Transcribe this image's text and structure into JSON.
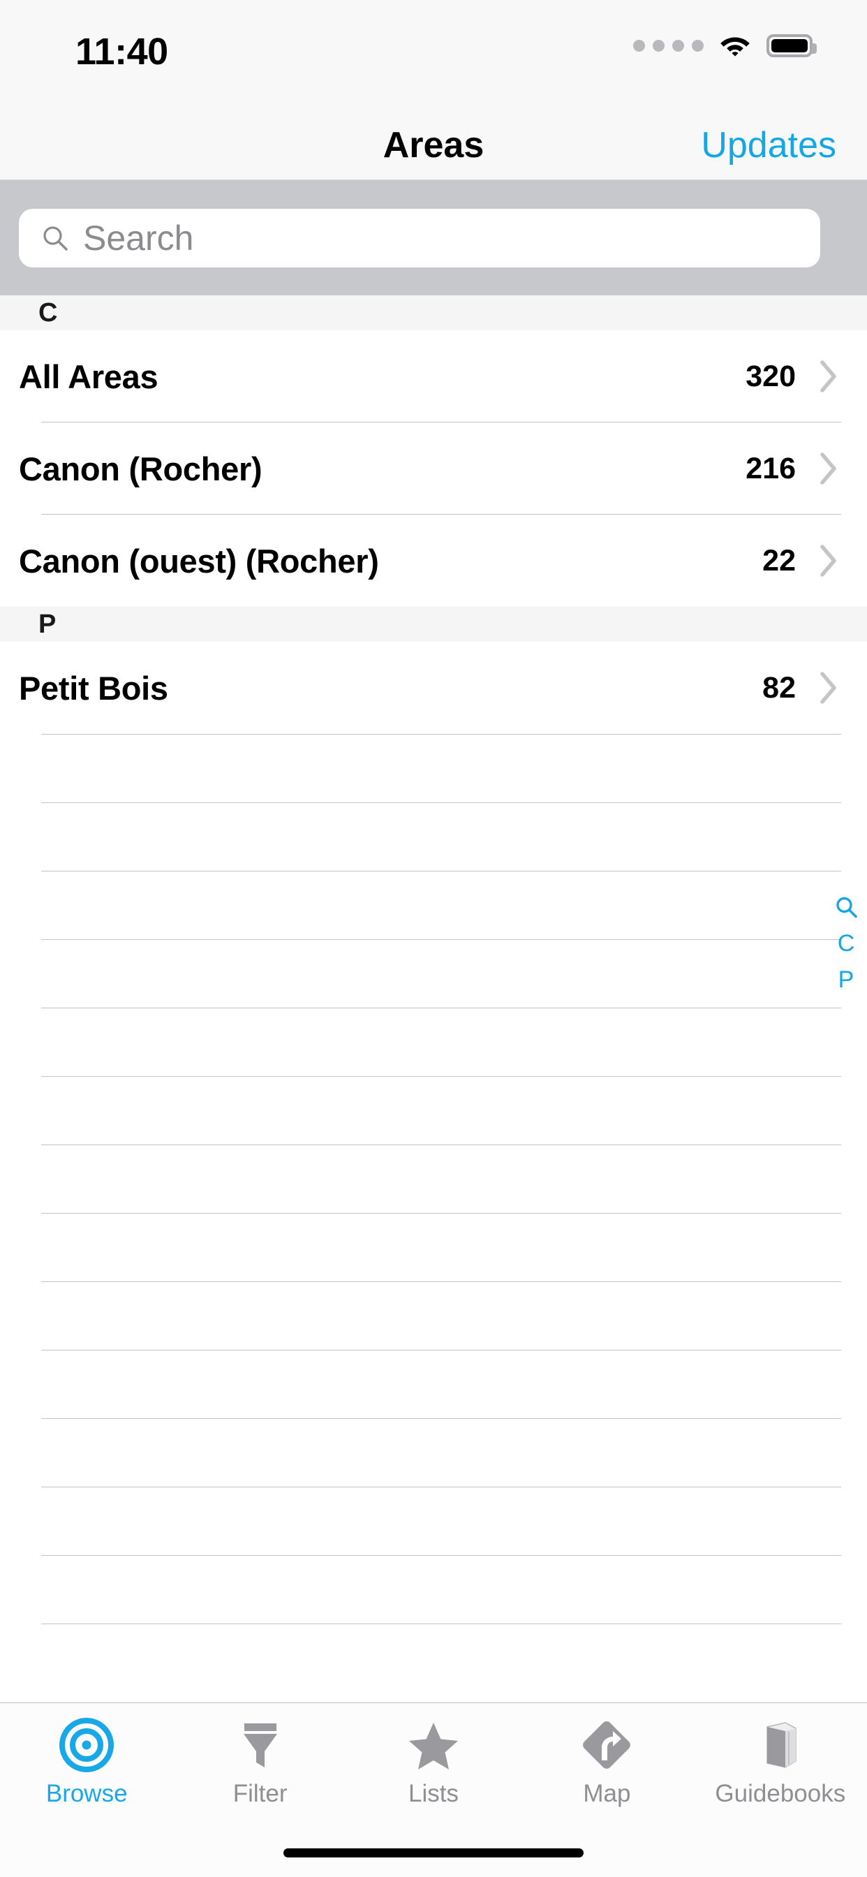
{
  "theme": {
    "accent": "#14a7e6",
    "nav_bg": "#f8f8f8",
    "search_bg": "#c7c8cc",
    "section_bg": "#f5f5f5",
    "separator": "#c4c4c6",
    "inactive_tab": "#8e8e93",
    "row_text": "#000000"
  },
  "status_bar": {
    "time": "11:40",
    "signal_icon": "cellular-dots-icon",
    "signal_dots": 4,
    "signal_active": 0,
    "wifi_icon": "wifi-icon",
    "battery_icon": "battery-full-icon"
  },
  "nav_bar": {
    "title": "Areas",
    "right_button": "Updates"
  },
  "search": {
    "icon": "search-icon",
    "placeholder": "Search",
    "value": ""
  },
  "list": {
    "sections": [
      {
        "header": "C",
        "rows": [
          {
            "label": "All Areas",
            "count": "320",
            "chevron": "chevron-right-icon"
          },
          {
            "label": "Canon (Rocher)",
            "count": "216",
            "chevron": "chevron-right-icon"
          },
          {
            "label": "Canon (ouest) (Rocher)",
            "count": "22",
            "chevron": "chevron-right-icon"
          }
        ]
      },
      {
        "header": "P",
        "rows": [
          {
            "label": "Petit Bois",
            "count": "82",
            "chevron": "chevron-right-icon"
          }
        ]
      }
    ],
    "empty_rows": 14
  },
  "index_rail": {
    "items": [
      {
        "label": "",
        "icon": "search-icon"
      },
      {
        "label": "C",
        "icon": ""
      },
      {
        "label": "P",
        "icon": ""
      }
    ]
  },
  "tab_bar": {
    "active": "Browse",
    "tabs": [
      {
        "label": "Browse",
        "icon": "bullseye-target-icon",
        "active": true
      },
      {
        "label": "Filter",
        "icon": "funnel-icon",
        "active": false
      },
      {
        "label": "Lists",
        "icon": "star-icon",
        "active": false
      },
      {
        "label": "Map",
        "icon": "map-diamond-arrow-icon",
        "active": false
      },
      {
        "label": "Guidebooks",
        "icon": "book-icon",
        "active": false
      }
    ]
  },
  "home_indicator": "home-indicator"
}
